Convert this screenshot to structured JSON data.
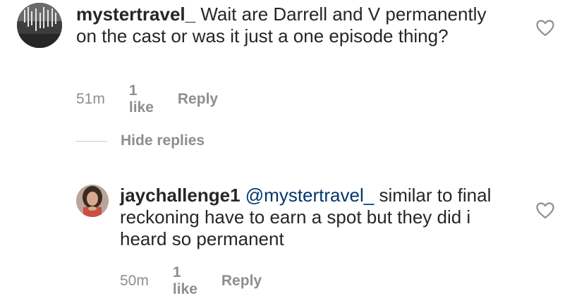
{
  "comments": [
    {
      "username": "mystertravel_",
      "text": " Wait are Darrell and V permanently on the cast or was it just a one episode thing?",
      "time": "51m",
      "likes": "1 like",
      "reply": "Reply"
    }
  ],
  "hide_replies": {
    "label": "Hide replies"
  },
  "replies": [
    {
      "username": "jaychallenge1",
      "mention": "@mystertravel_",
      "text": " similar to final reckoning have to earn a spot but they did i heard so permanent",
      "time": "50m",
      "likes": "1 like",
      "reply": "Reply"
    }
  ],
  "icons": {
    "like": "heart-outline-icon"
  }
}
